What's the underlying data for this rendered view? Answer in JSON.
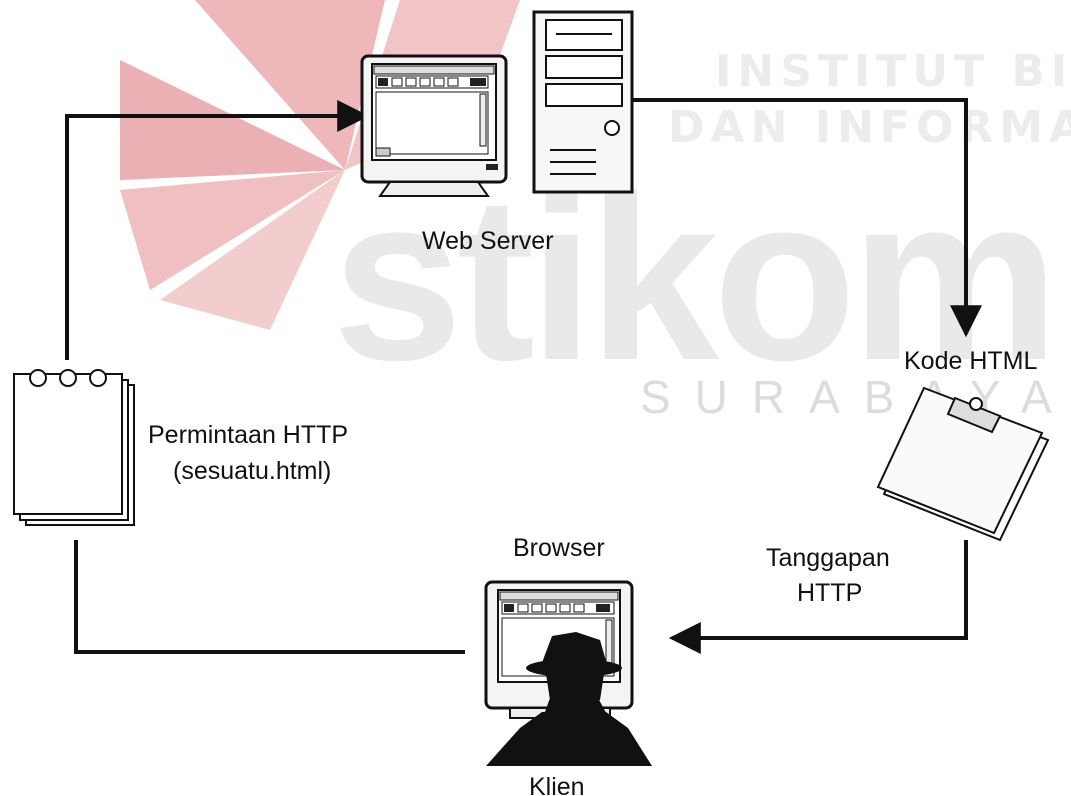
{
  "watermark": {
    "line1": "INSTITUT BISN",
    "line2": "DAN INFORMATIK",
    "brand": "stikom",
    "city": "SURABAYA"
  },
  "labels": {
    "web_server": "Web Server",
    "kode_html": "Kode HTML",
    "permintaan_line1": "Permintaan HTTP",
    "permintaan_line2": "(sesuatu.html)",
    "browser": "Browser",
    "tanggapan_line1": "Tanggapan",
    "tanggapan_line2": "HTTP",
    "klien": "Klien"
  },
  "colors": {
    "background": "#ffffff",
    "line": "#111111",
    "watermark_red": "#e7a9ac",
    "watermark_grey": "#e9e9e9"
  }
}
